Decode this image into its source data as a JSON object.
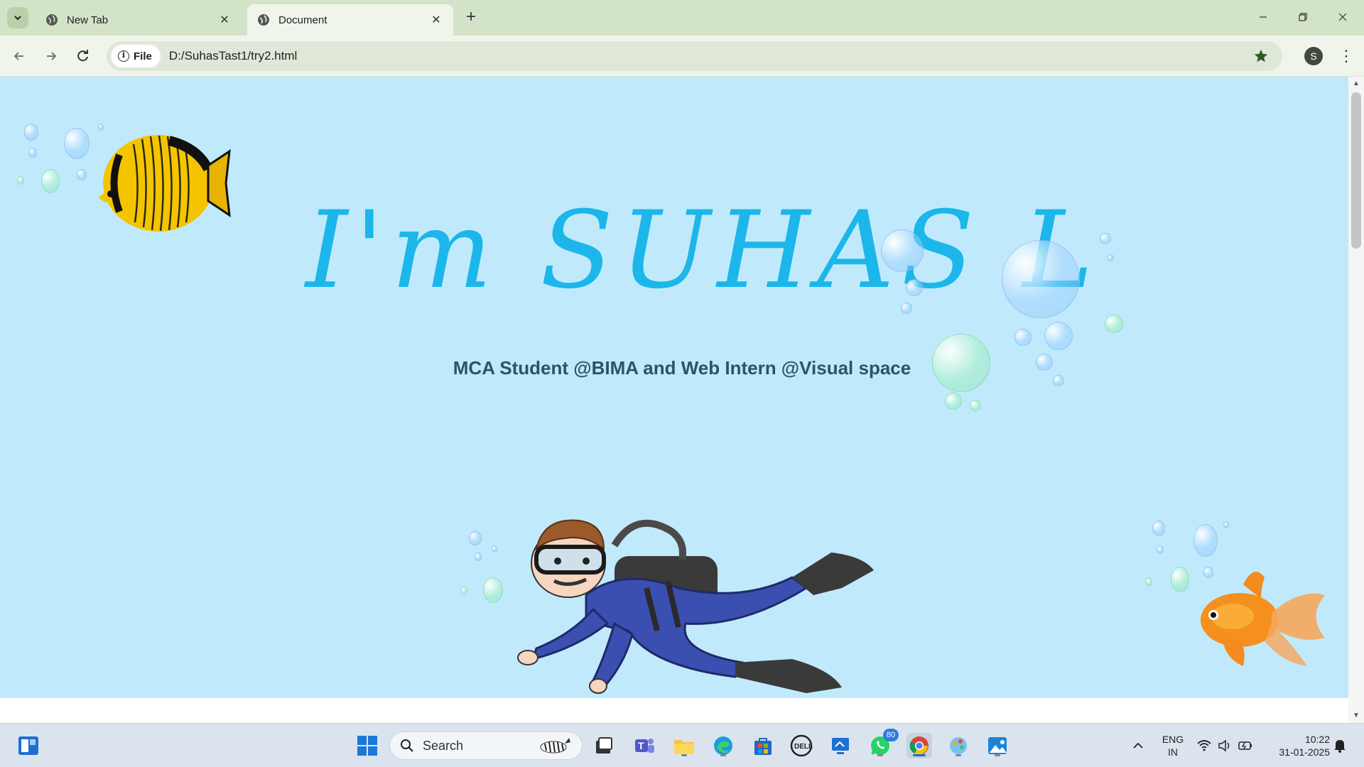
{
  "browser": {
    "tabs": [
      {
        "title": "New Tab",
        "active": false
      },
      {
        "title": "Document",
        "active": true
      }
    ],
    "new_tab_symbol": "+",
    "file_chip_label": "File",
    "url": "D:/SuhasTast1/try2.html",
    "profile_initial": "S",
    "theme_color": "#d3e3c8"
  },
  "page": {
    "hero_title": "I'm SUHAS L",
    "subtitle": "MCA Student @BIMA and Web Intern @Visual space",
    "background_color": "#c0eafb",
    "title_color": "#1cb6ea",
    "images": [
      "butterflyfish-image",
      "diver-image",
      "goldfish-image",
      "bubbles-image"
    ]
  },
  "taskbar": {
    "search_placeholder": "Search",
    "whatsapp_badge": "80",
    "language_top": "ENG",
    "language_bottom": "IN",
    "time": "10:22",
    "date": "31-01-2025"
  }
}
